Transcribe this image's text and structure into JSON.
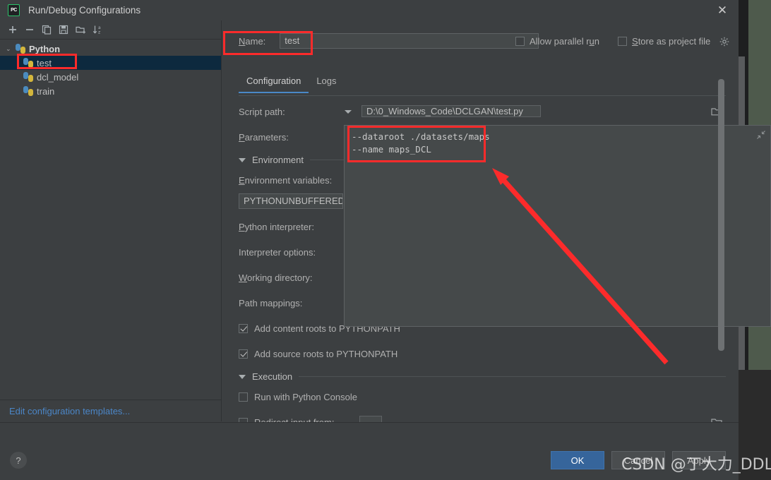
{
  "window": {
    "title": "Run/Debug Configurations",
    "logo_text": "PC",
    "close_label": "✕"
  },
  "left_pane": {
    "toolbar": [
      {
        "name": "add-configuration-button",
        "icon": "plus-icon",
        "label": "+"
      },
      {
        "name": "remove-configuration-button",
        "icon": "minus-icon",
        "label": "−"
      },
      {
        "name": "copy-configuration-button",
        "icon": "copy-icon",
        "label": "copy"
      },
      {
        "name": "save-configuration-button",
        "icon": "save-icon",
        "label": "save"
      },
      {
        "name": "new-folder-button",
        "icon": "folder-add-icon",
        "label": "folder+"
      },
      {
        "name": "sort-configurations-button",
        "icon": "sort-alpha-icon",
        "label": "sort"
      }
    ],
    "tree": {
      "root": {
        "label": "Python",
        "expanded": true,
        "arrow": "⌄"
      },
      "children": [
        {
          "label": "test",
          "selected": true
        },
        {
          "label": "dcl_model",
          "selected": false
        },
        {
          "label": "train",
          "selected": false
        }
      ]
    },
    "footer_link": "Edit configuration templates..."
  },
  "right_pane": {
    "name_label": "Name:",
    "name_label_mnemonic": "N",
    "name_value": "test",
    "allow_parallel_run": {
      "label": "Allow parallel run",
      "checked": false,
      "mnemonic": "u"
    },
    "store_as_project_file": {
      "label": "Store as project file",
      "checked": false,
      "mnemonic": "S"
    },
    "gear_icon": "gear-icon",
    "tabs": [
      {
        "label": "Configuration",
        "active": true
      },
      {
        "label": "Logs",
        "active": false
      }
    ],
    "script_path": {
      "label": "Script path:",
      "value": "D:\\0_Windows_Code\\DCLGAN\\test.py",
      "dropdown_icon": "chevron-down-icon",
      "browse_icon": "folder-icon"
    },
    "parameters": {
      "label": "Parameters:",
      "mnemonic": "P",
      "value": "--dataroot ./datasets/maps\n--name maps_DCL",
      "shrink_icon": "collapse-diagonal-icon"
    },
    "environment_section": {
      "title": "Environment",
      "expanded": true,
      "env_vars_label": "Environment variables:",
      "env_vars_mnemonic": "E",
      "env_vars_value": "PYTHONUNBUFFERED="
    },
    "fields": [
      {
        "label": "Python interpreter:",
        "mnemonic": "P",
        "value": ""
      },
      {
        "label": "Interpreter options:",
        "mnemonic": "",
        "value": ""
      },
      {
        "label": "Working directory:",
        "mnemonic": "W",
        "value": ""
      },
      {
        "label": "Path mappings:",
        "mnemonic": "",
        "value": ""
      }
    ],
    "path_checkboxes": [
      {
        "label": "Add content roots to PYTHONPATH",
        "checked": true
      },
      {
        "label": "Add source roots to PYTHONPATH",
        "checked": true
      }
    ],
    "execution_section": {
      "title": "Execution",
      "expanded": true,
      "run_with_console": {
        "label": "Run with Python Console",
        "checked": false
      },
      "redirect_input": {
        "label": "Redirect input from:",
        "checked": false,
        "value": "",
        "browse_icon": "folder-icon"
      }
    }
  },
  "bottom_bar": {
    "help_label": "?",
    "buttons": [
      {
        "label": "OK",
        "primary": true
      },
      {
        "label": "Cancel",
        "primary": false
      },
      {
        "label": "Apply",
        "primary": false
      }
    ]
  },
  "watermark": "CSDN @丁大力_DDL",
  "colors": {
    "accent_blue": "#4a88c7",
    "annotation_red": "#fc2b2b",
    "selection_blue": "#0d293e",
    "panel_bg": "#3c3f41",
    "field_bg": "#45494a",
    "link_blue": "#4b86c7",
    "desktop_green": "#4e5a4c"
  }
}
